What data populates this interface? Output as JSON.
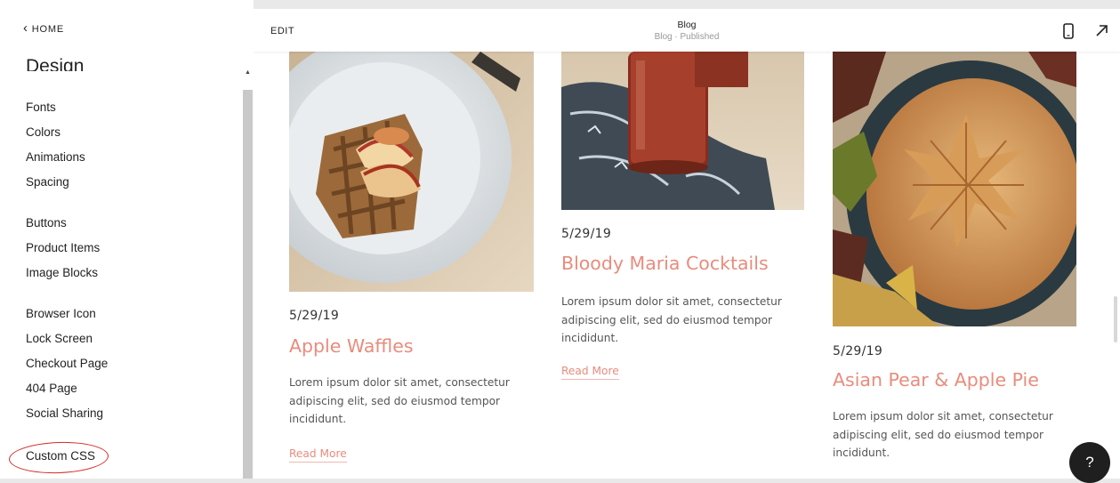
{
  "sidebar": {
    "home_label": "HOME",
    "section_title": "Design",
    "groups": [
      [
        "Fonts",
        "Colors",
        "Animations",
        "Spacing"
      ],
      [
        "Buttons",
        "Product Items",
        "Image Blocks"
      ],
      [
        "Browser Icon",
        "Lock Screen",
        "Checkout Page",
        "404 Page",
        "Social Sharing"
      ]
    ],
    "custom_css_label": "Custom CSS",
    "annotation_color": "#d42a2a"
  },
  "topbar": {
    "edit_label": "EDIT",
    "page_title": "Blog",
    "page_status": "Blog · Published",
    "icons": [
      "mobile-preview-icon",
      "expand-icon"
    ]
  },
  "posts": [
    {
      "image": "apple-waffles-photo",
      "date": "5/29/19",
      "title": "Apple Waffles",
      "excerpt": "Lorem ipsum dolor sit amet, consectetur adipiscing elit, sed do eiusmod tempor incididunt.",
      "read_more": "Read More"
    },
    {
      "image": "bloody-maria-photo",
      "date": "5/29/19",
      "title": "Bloody Maria Cocktails",
      "excerpt": "Lorem ipsum dolor sit amet, consectetur adipiscing elit, sed do eiusmod tempor incididunt.",
      "read_more": "Read More"
    },
    {
      "image": "pie-photo",
      "date": "5/29/19",
      "title": "Asian Pear & Apple Pie",
      "excerpt": "Lorem ipsum dolor sit amet, consectetur adipiscing elit, sed do eiusmod tempor incididunt.",
      "read_more": "Read More"
    }
  ],
  "help_label": "?",
  "colors": {
    "accent": "#e88c7d",
    "text": "#222222",
    "muted": "#999999"
  }
}
